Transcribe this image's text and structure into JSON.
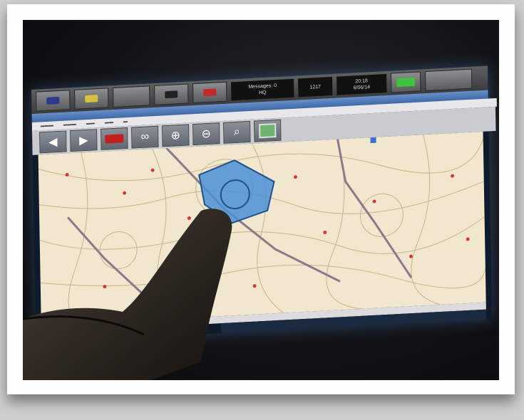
{
  "topbar": {
    "messages_line1": "Messages: 0",
    "messages_line2": "HQ",
    "unit": "1217",
    "time": "20:18",
    "date": "6/06/14"
  },
  "colors": {
    "map_background": "#f1e7cf",
    "selection": "#4c8fd6",
    "pins": "#d23a3a"
  },
  "toolbar": {
    "icons": [
      "arrow-left-icon",
      "arrow-right-icon",
      "fire-truck-icon",
      "binoculars-icon",
      "zoom-in-icon",
      "zoom-out-icon",
      "zoom-extent-icon",
      "map-layer-icon"
    ]
  }
}
